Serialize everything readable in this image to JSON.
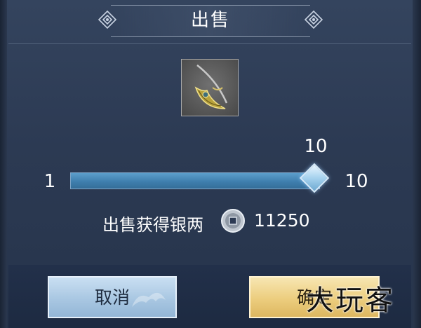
{
  "dialog": {
    "title": "出售"
  },
  "item": {
    "icon": "crescent-blade-icon"
  },
  "quantity": {
    "current": "10",
    "min": "1",
    "max": "10",
    "fill_fraction": 1.0
  },
  "earnings": {
    "label": "出售获得银两",
    "currency_icon": "silver-coin-icon",
    "amount": "11250"
  },
  "buttons": {
    "cancel_label": "取消",
    "confirm_label": "确定"
  },
  "watermark": {
    "text": "大玩客"
  },
  "colors": {
    "panel": "#2c3a53",
    "slider_fill": "#4a8dbd",
    "cancel_button": "#a9c7e2",
    "confirm_button": "#eccd7e"
  }
}
